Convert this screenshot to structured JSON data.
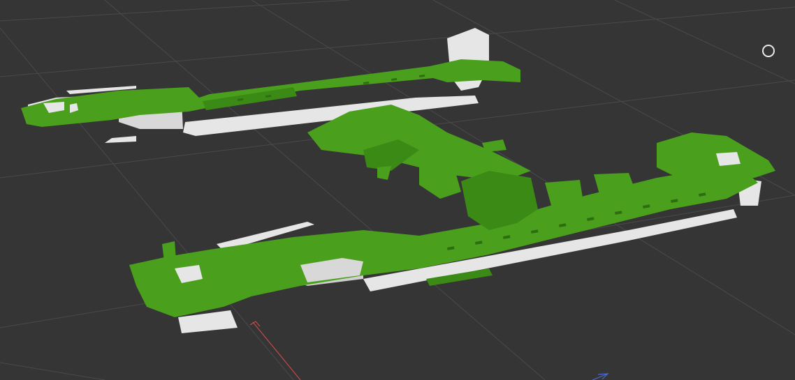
{
  "viewport": {
    "background_color": "#353535",
    "grid_color": "#4a4a4a",
    "x_axis_color": "#c44a4a",
    "z_axis_color": "#4a6ad0"
  },
  "model": {
    "overlay_color": "#4aa01c",
    "overlay_dark_color": "#357a12",
    "base_color": "#e6e6e6",
    "base_shadow_color": "#bdbdbd"
  },
  "gizmo": {
    "icon": "orbit-circle-icon"
  }
}
